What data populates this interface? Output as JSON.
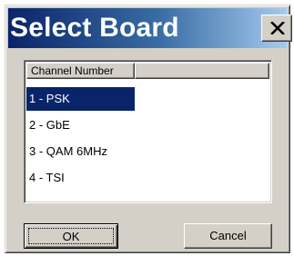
{
  "dialog": {
    "title": "Select Board",
    "close_icon": "close-icon"
  },
  "list": {
    "column_header": "Channel Number",
    "items": [
      {
        "label": "1 - PSK",
        "selected": true
      },
      {
        "label": "2 - GbE",
        "selected": false
      },
      {
        "label": "3 - QAM 6MHz",
        "selected": false
      },
      {
        "label": "4 - TSI",
        "selected": false
      }
    ]
  },
  "buttons": {
    "ok_label": "OK",
    "cancel_label": "Cancel"
  },
  "colors": {
    "title_bar_start": "#0a246a",
    "title_bar_end": "#a6caf0",
    "selection": "#0a246a",
    "face": "#d4d0c8"
  }
}
